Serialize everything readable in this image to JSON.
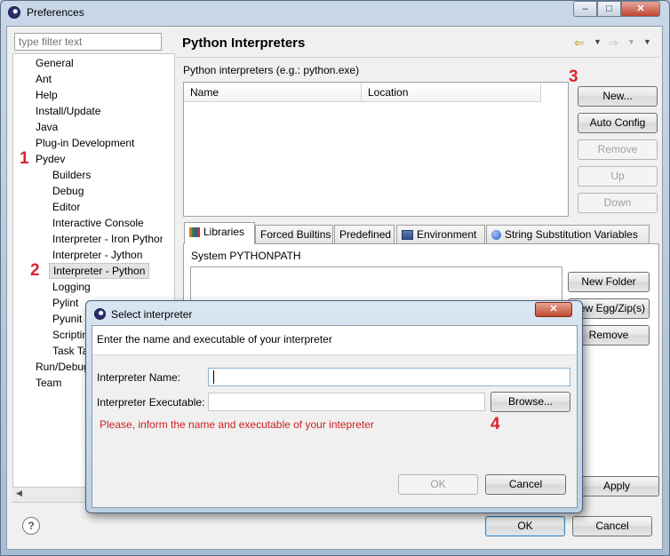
{
  "window": {
    "title": "Preferences",
    "minimize": "‒",
    "maximize": "□",
    "close": "✕"
  },
  "sidebar": {
    "filter_placeholder": "type filter text",
    "items": [
      "General",
      "Ant",
      "Help",
      "Install/Update",
      "Java",
      "Plug-in Development",
      "Pydev",
      "Builders",
      "Debug",
      "Editor",
      "Interactive Console",
      "Interpreter - Iron Python",
      "Interpreter - Jython",
      "Interpreter - Python",
      "Logging",
      "Pylint",
      "Pyunit",
      "Scripting",
      "Task Tags",
      "Run/Debug",
      "Team"
    ]
  },
  "annotations": [
    "1",
    "2",
    "3",
    "4"
  ],
  "page": {
    "title": "Python Interpreters",
    "interpreters_label": "Python interpreters (e.g.: python.exe)",
    "columns": [
      "Name",
      "Location"
    ],
    "buttons": {
      "new": "New...",
      "auto_config": "Auto Config",
      "remove": "Remove",
      "up": "Up",
      "down": "Down"
    },
    "tabs": [
      "Libraries",
      "Forced Builtins",
      "Predefined",
      "Environment",
      "String Substitution Variables"
    ],
    "libraries": {
      "label": "System PYTHONPATH",
      "new_folder": "New Folder",
      "new_egg": "New Egg/Zip(s)",
      "remove": "Remove"
    },
    "apply": "Apply"
  },
  "footer": {
    "ok": "OK",
    "cancel": "Cancel",
    "help": "?"
  },
  "dialog": {
    "title": "Select interpreter",
    "message": "Enter the name and executable of your interpreter",
    "name_label": "Interpreter Name:",
    "name_value": "",
    "exec_label": "Interpreter Executable:",
    "exec_value": "",
    "browse": "Browse...",
    "error": "Please, inform the name and executable of your intepreter",
    "ok": "OK",
    "cancel": "Cancel",
    "close": "✕"
  },
  "colors": {
    "annotation": "#d9242d",
    "error_text": "#cc1f1f"
  }
}
